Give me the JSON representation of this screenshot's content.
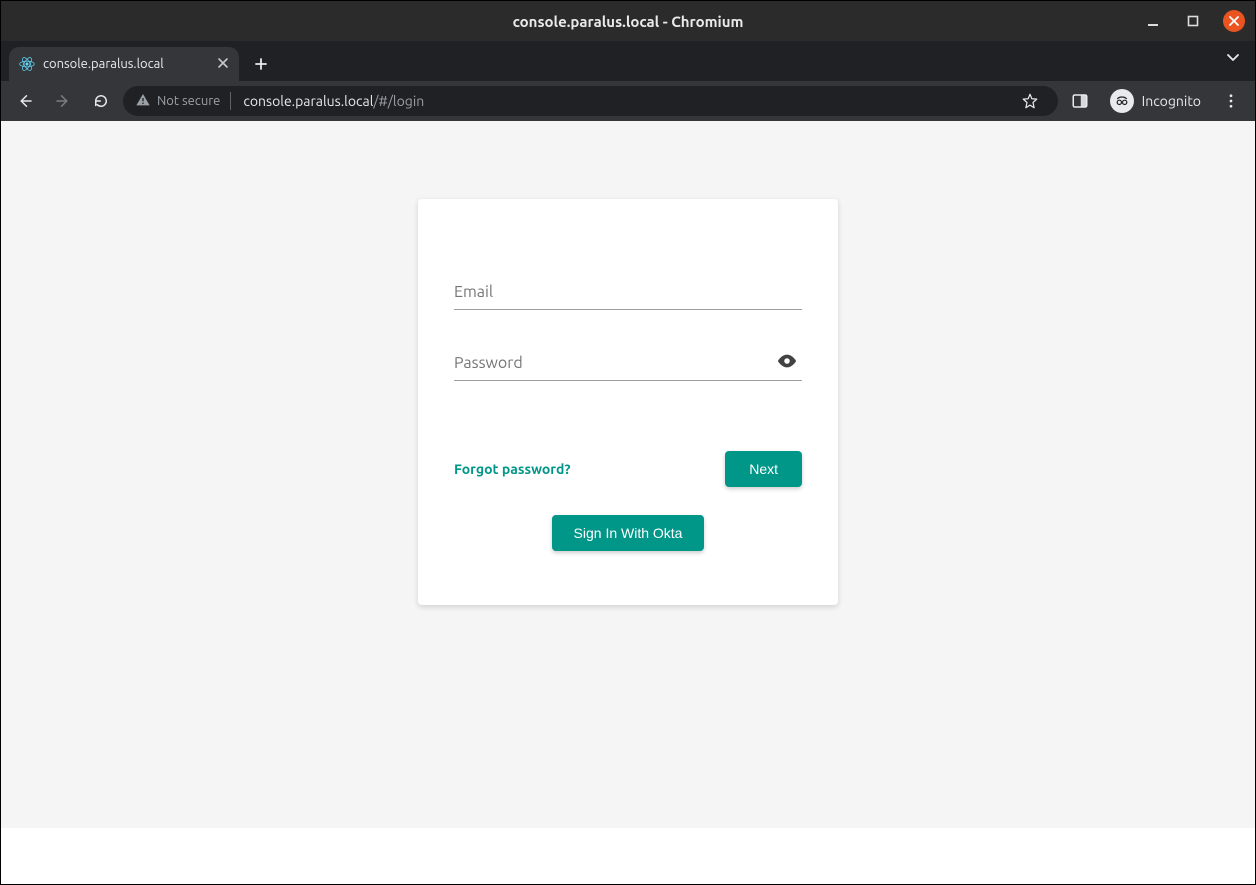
{
  "window": {
    "title": "console.paralus.local - Chromium"
  },
  "browser": {
    "tab_title": "console.paralus.local",
    "security_label": "Not secure",
    "url_host": "console.paralus.local",
    "url_path": "/#/login",
    "incognito_label": "Incognito"
  },
  "login": {
    "email_label": "Email",
    "email_value": "",
    "password_label": "Password",
    "password_value": "",
    "forgot_label": "Forgot password?",
    "next_label": "Next",
    "okta_label": "Sign In With Okta"
  },
  "colors": {
    "accent": "#009688",
    "page_bg": "#f5f5f5",
    "card_bg": "#ffffff"
  }
}
